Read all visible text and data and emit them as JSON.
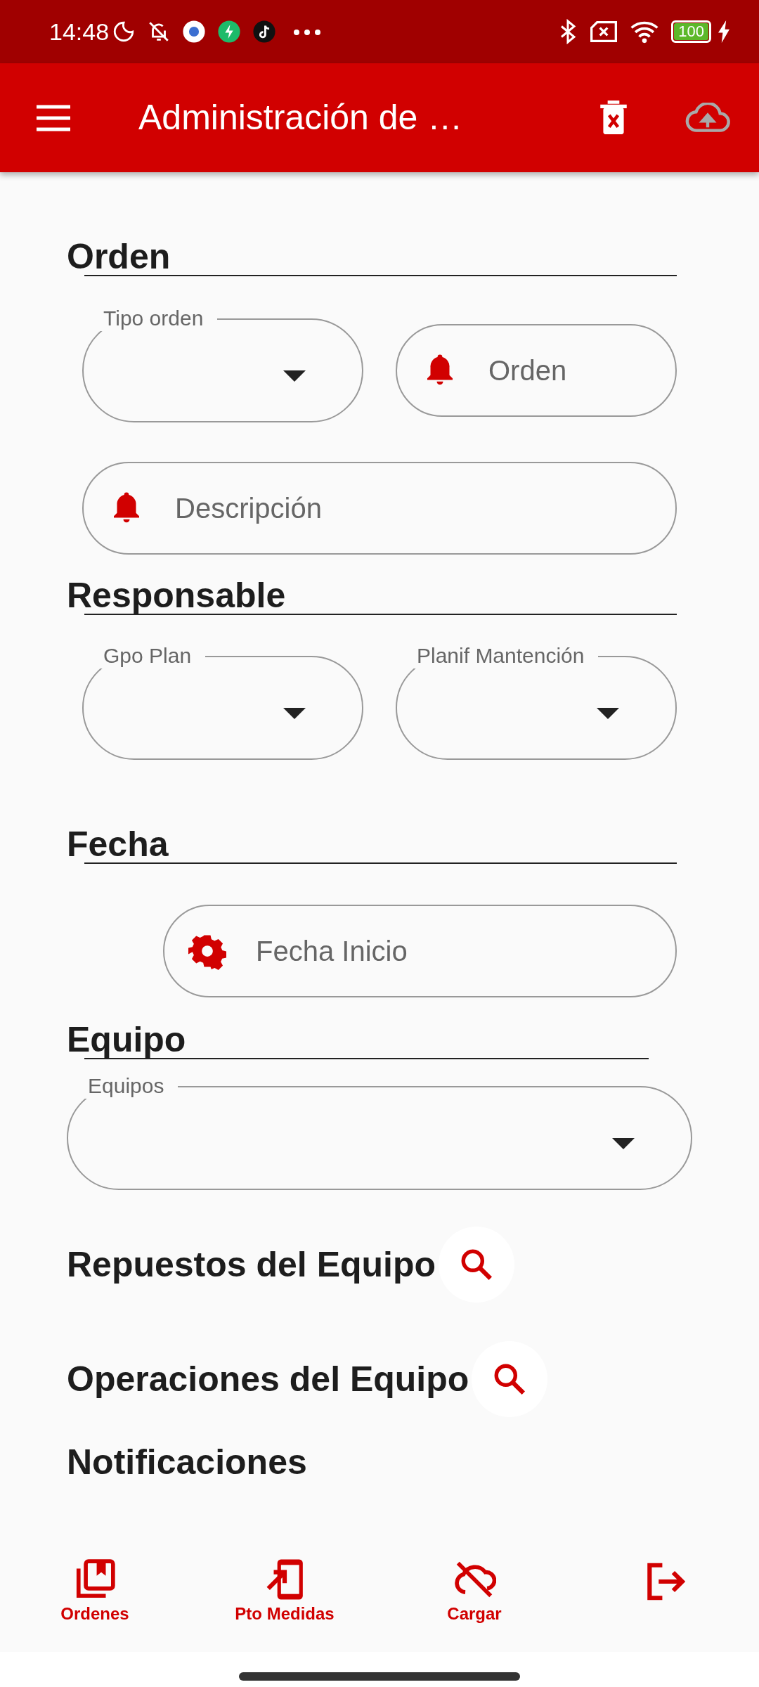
{
  "status_bar": {
    "time": "14:48",
    "battery": "100"
  },
  "app_bar": {
    "title": "Administración de …",
    "actions": [
      {
        "kind": "delete",
        "disabled": false
      },
      {
        "kind": "upload",
        "disabled": true
      }
    ]
  },
  "sections": [
    {
      "heading": "Orden",
      "rows": [
        [
          {
            "kind": "dropdown",
            "label": "Tipo orden"
          },
          {
            "kind": "input",
            "placeholder": "Orden"
          }
        ],
        [
          {
            "kind": "input",
            "placeholder": "Descripción"
          }
        ]
      ]
    },
    {
      "heading": "Responsable",
      "rows": [
        [
          {
            "kind": "dropdown",
            "label": "Gpo Plan"
          },
          {
            "kind": "dropdown",
            "label": "Planif Mantención"
          }
        ]
      ]
    },
    {
      "heading": "Fecha",
      "rows": [
        [
          {
            "kind": "date",
            "placeholder": "Fecha Inicio"
          }
        ]
      ]
    },
    {
      "heading": "Equipo",
      "rows": [
        [
          {
            "kind": "dropdown",
            "label": "Equipos"
          }
        ]
      ]
    }
  ],
  "lists": [
    {
      "title": "Repuestos del Equipo",
      "search": true
    },
    {
      "title": "Operaciones del Equipo",
      "search": true
    },
    {
      "title": "Notificaciones"
    }
  ],
  "bottom_nav": [
    {
      "kind": "orders",
      "label": "Ordenes"
    },
    {
      "kind": "measures",
      "label": "Pto Medidas"
    },
    {
      "kind": "cloud-off",
      "label": "Cargar"
    },
    {
      "kind": "logout"
    }
  ]
}
